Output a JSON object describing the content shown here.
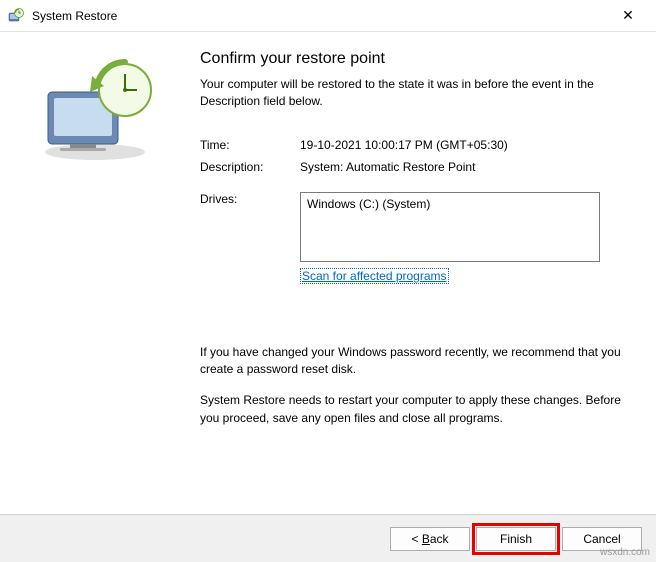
{
  "window": {
    "title": "System Restore",
    "close_glyph": "✕"
  },
  "main": {
    "heading": "Confirm your restore point",
    "subtext": "Your computer will be restored to the state it was in before the event in the Description field below.",
    "time_label": "Time:",
    "time_value": "19-10-2021 10:00:17 PM (GMT+05:30)",
    "description_label": "Description:",
    "description_value": "System: Automatic Restore Point",
    "drives_label": "Drives:",
    "drives_value": "Windows (C:) (System)",
    "scan_link": "Scan for affected programs",
    "note1": "If you have changed your Windows password recently, we recommend that you create a password reset disk.",
    "note2": "System Restore needs to restart your computer to apply these changes. Before you proceed, save any open files and close all programs."
  },
  "footer": {
    "back_prefix": "< ",
    "back_accel": "B",
    "back_suffix": "ack",
    "finish": "Finish",
    "cancel": "Cancel"
  },
  "watermark": "wsxdn.com"
}
